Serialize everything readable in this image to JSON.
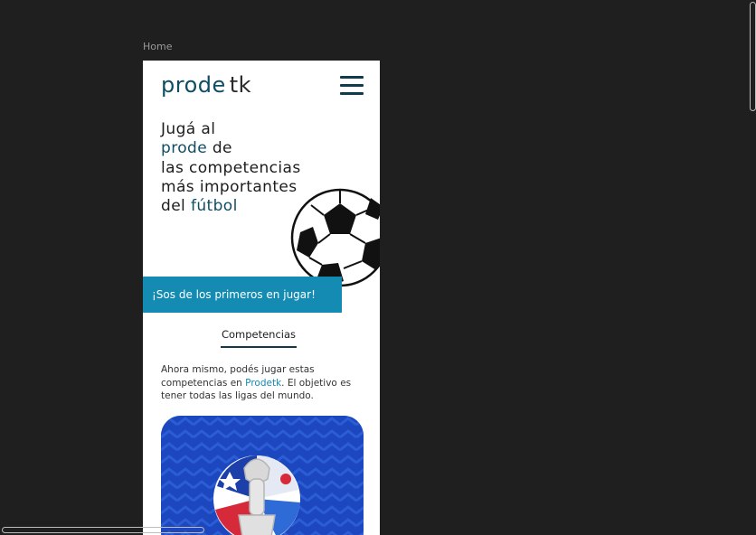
{
  "page": {
    "label": "Home"
  },
  "header": {
    "brand_part1": "prode",
    "brand_part2": "tk",
    "menu_icon": "hamburger-menu-icon"
  },
  "hero": {
    "line1": "Jugá al",
    "line2_accent": "prode",
    "line2_rest": " de",
    "line3": "las competencias",
    "line4": "más importantes",
    "line5_prefix": "del ",
    "line5_accent": "fútbol",
    "illustration_icon": "soccer-ball-icon"
  },
  "cta": {
    "label": "¡Sos de los primeros en jugar!"
  },
  "competitions": {
    "title": "Competencias",
    "intro_before": "Ahora mismo, podés jugar estas competencias en ",
    "intro_link": "Prodetk",
    "intro_after": ". El objetivo es tener todas las ligas del mundo.",
    "card_icon": "copa-america-trophy-icon"
  },
  "colors": {
    "background": "#1f1f1f",
    "brand": "#0f4d64",
    "accent": "#138bb3",
    "card": "#1f4fc8"
  }
}
